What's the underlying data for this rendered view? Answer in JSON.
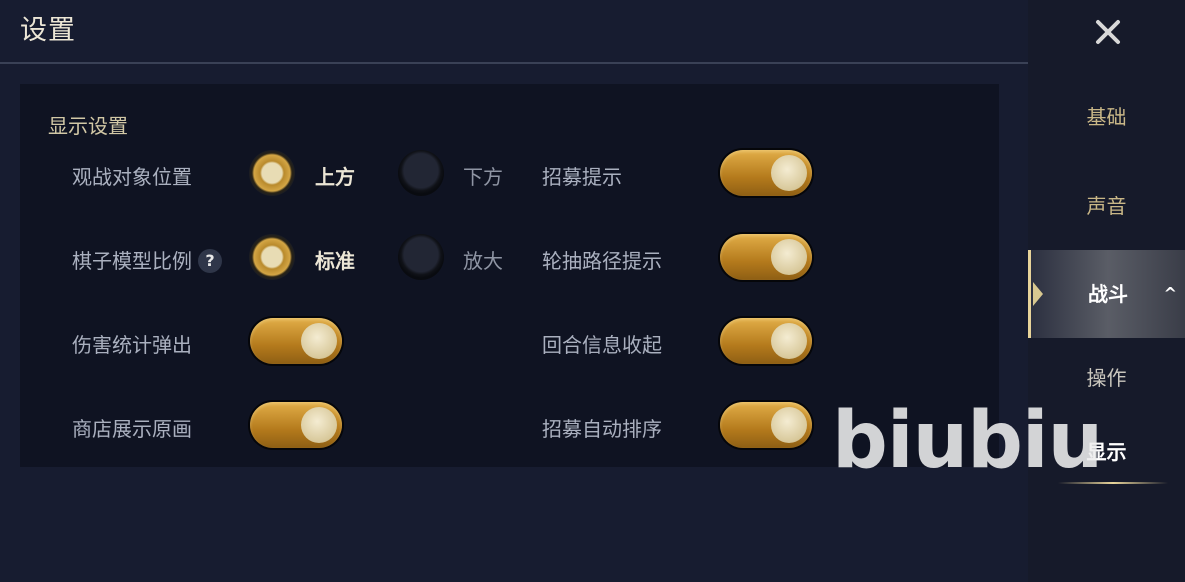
{
  "page": {
    "title": "设置"
  },
  "panel": {
    "section_title": "显示设置",
    "left_rows": [
      {
        "label": "观战对象位置",
        "options": [
          {
            "label": "上方",
            "selected": true
          },
          {
            "label": "下方",
            "selected": false
          }
        ]
      },
      {
        "label": "棋子模型比例",
        "help_icon": "?",
        "options": [
          {
            "label": "标准",
            "selected": true
          },
          {
            "label": "放大",
            "selected": false
          }
        ]
      },
      {
        "label": "伤害统计弹出",
        "toggle": true
      },
      {
        "label": "商店展示原画",
        "toggle": true
      }
    ],
    "right_rows": [
      {
        "label": "招募提示",
        "toggle": true
      },
      {
        "label": "轮抽路径提示",
        "toggle": true
      },
      {
        "label": "回合信息收起",
        "toggle": true
      },
      {
        "label": "招募自动排序",
        "toggle": true
      }
    ]
  },
  "sidebar": {
    "items": [
      "基础",
      "声音",
      "战斗"
    ],
    "active_item": "战斗",
    "sub_items": [
      "操作",
      "显示"
    ],
    "current_sub": "显示"
  },
  "watermark": "biubiu",
  "colors": {
    "accent_gold": "#d4a645",
    "toggle_on": "#b47a1c",
    "background": "#171c30"
  }
}
